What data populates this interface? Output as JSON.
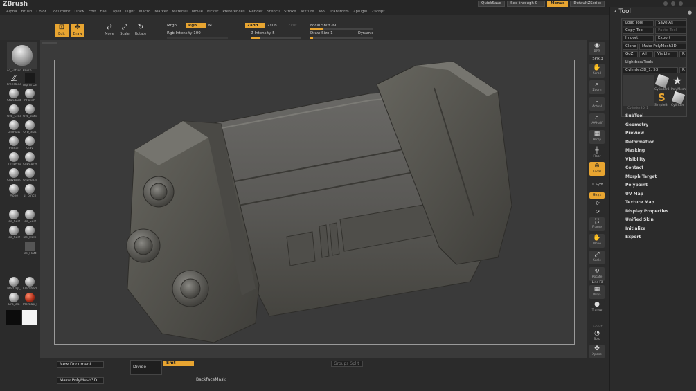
{
  "app": {
    "title": "ZBrush"
  },
  "menubar": [
    "Alpha",
    "Brush",
    "Color",
    "Document",
    "Draw",
    "Edit",
    "File",
    "Layer",
    "Light",
    "Macro",
    "Marker",
    "Material",
    "Movie",
    "Picker",
    "Preferences",
    "Render",
    "Stencil",
    "Stroke",
    "Texture",
    "Tool",
    "Transform",
    "Zplugin",
    "Zscript"
  ],
  "topright": {
    "quicksave": "QuickSave",
    "see_through": "See-through  0",
    "see_through_level": 0,
    "menus": "Menus",
    "default_zscript": "DefaultZScript"
  },
  "toolbar": {
    "edit": "Edit",
    "draw": "Draw",
    "move": "Move",
    "scale": "Scale",
    "rotate": "Rotate",
    "mrgb": "Mrgb",
    "rgb": "Rgb",
    "m": "M",
    "rgb_intensity": "Rgb Intensity 100",
    "zadd": "Zadd",
    "zsub": "Zsub",
    "zcut": "Zcut",
    "z_intensity": "Z Intensity 5",
    "focal_shift": "Focal Shift -60",
    "draw_size": "Draw Size 1",
    "dynamic": "Dynamic"
  },
  "leftshelf": {
    "current_brush": "sc_Fatten Brush",
    "brushes": [
      {
        "label": "FreeHand"
      },
      {
        "label": "Alpha Off"
      },
      {
        "label": "Standard"
      },
      {
        "label": "hPolish"
      },
      {
        "label": "Orb_Crac"
      },
      {
        "label": "Orb_cuts"
      },
      {
        "label": "OrbFlatt"
      },
      {
        "label": "Orb_Slat"
      },
      {
        "label": "Planar"
      },
      {
        "label": "Clay"
      },
      {
        "label": "TrimDyna"
      },
      {
        "label": "ClipCurve"
      },
      {
        "label": "ClayBuild"
      },
      {
        "label": "OrbFlatte"
      },
      {
        "label": "Move"
      },
      {
        "label": "ui_pinch"
      },
      {
        "label": "ice_Surf"
      },
      {
        "label": "ice_Surf"
      },
      {
        "label": "ice_Surf"
      },
      {
        "label": "ice_Hole"
      },
      {
        "label": "ice_Flatt"
      },
      {
        "label": "MatCap_"
      },
      {
        "label": "FlatShad"
      },
      {
        "label": "Orb_cla"
      },
      {
        "label": "MatCap_I"
      }
    ]
  },
  "rightshelf": {
    "bpr": "BPR",
    "spix": "SPix 3",
    "scroll": "Scroll",
    "zoom": "Zoom",
    "actual": "Actual",
    "aahalf": "AAHalf",
    "persp": "Persp",
    "floor": "Floor",
    "local": "Local",
    "lsym": "L.Sym",
    "gxyz": "Gxyz",
    "frame": "Frame",
    "move": "Move",
    "scale": "Scale",
    "rotate": "Rotate",
    "linefill": "Line Fill",
    "polyf": "PolyF",
    "transp": "Transp",
    "ghost": "Ghost",
    "solo": "Solo",
    "xpose": "Xpose"
  },
  "rightpanel": {
    "header": "Tool",
    "buttons": {
      "load_tool": "Load Tool",
      "save_as": "Save As",
      "copy_tool": "Copy Tool",
      "paste_tool": "Paste Tool",
      "import": "Import",
      "export": "Export",
      "clone": "Clone",
      "make_polymesh": "Make PolyMesh3D",
      "goz": "GoZ",
      "all": "All",
      "visible": "Visible",
      "r": "R",
      "lightbox_tools": "Lightbox▸Tools",
      "current_tool": "Cylinder3D_1. 53",
      "r2": "R"
    },
    "thumbs": {
      "main": "Cylinder3D_1",
      "t1": "Cylinder3",
      "t2": "PolyMesh",
      "t3": "SimpleBr",
      "t4": "Cylinder"
    },
    "subpalettes": [
      "SubTool",
      "Geometry",
      "Preview",
      "Deformation",
      "Masking",
      "Visibility",
      "Contact",
      "Morph Target",
      "Polypaint",
      "UV Map",
      "Texture Map",
      "Display Properties",
      "Unified Skin",
      "Initialize",
      "Export"
    ]
  },
  "bottom": {
    "new_document": "New Document",
    "make_polymesh": "Make PolyMesh3D",
    "divide": "Divide",
    "smt": "Smt",
    "groups_split": "Groups Split",
    "backface_mask": "BackfaceMask"
  },
  "colors": {
    "accent": "#e8a531",
    "mesh": "#5b5a57",
    "canvas": "#3a3a3a"
  }
}
